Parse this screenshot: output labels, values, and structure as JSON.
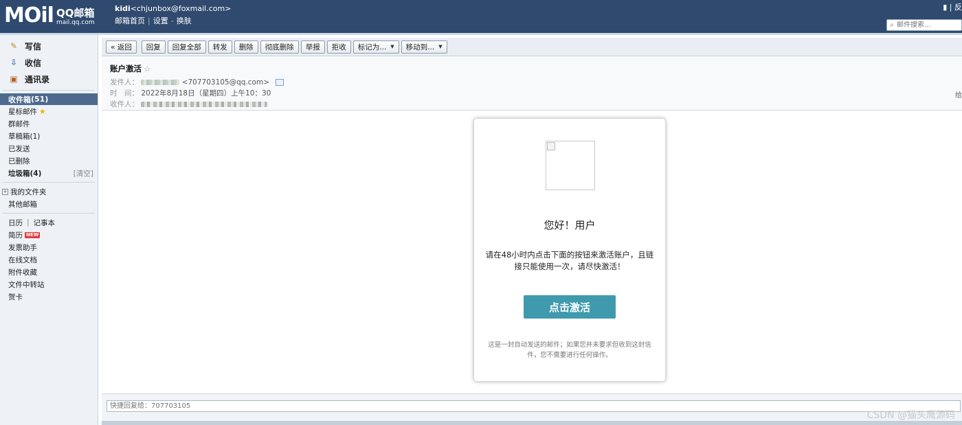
{
  "header": {
    "logo_text": "MOil",
    "logo_brand": "QQ邮箱",
    "logo_url": "mail.qq.com",
    "user_name": "kidi",
    "user_email": "<chjunbox@foxmail.com>",
    "links": [
      "邮箱首页",
      "设置",
      "换肤"
    ],
    "top_right": "反",
    "search_placeholder": "邮件搜索..."
  },
  "sidebar": {
    "compose": [
      {
        "label": "写信",
        "icon": "pencil-note-icon"
      },
      {
        "label": "收信",
        "icon": "inbox-tray-icon"
      },
      {
        "label": "通讯录",
        "icon": "address-book-icon"
      }
    ],
    "inbox": {
      "label": "收件箱",
      "count": "(51)"
    },
    "folders": {
      "starred": "星标邮件",
      "group": "群邮件",
      "drafts": "草稿箱(1)",
      "sent": "已发送",
      "deleted": "已删除",
      "spam": "垃圾箱(4)",
      "spam_clear": "[清空]"
    },
    "my_folders": "我的文件夹",
    "other_mailbox": "其他邮箱",
    "tools": {
      "calendar": "日历",
      "notes": "记事本",
      "resume": "简历",
      "new_badge": "NEW",
      "invoice": "发票助手",
      "online_docs": "在线文档",
      "attachments": "附件收藏",
      "file_transfer": "文件中转站",
      "greeting_card": "贺卡"
    }
  },
  "toolbar": {
    "back": "« 返回",
    "reply": "回复",
    "reply_all": "回复全部",
    "forward": "转发",
    "delete": "删除",
    "delete_perm": "彻底删除",
    "report": "举报",
    "reject": "拒收",
    "mark_as": "标记为...",
    "move_to": "移动到..."
  },
  "mail": {
    "subject": "账户激活",
    "star": "☆",
    "from_label": "发件人：",
    "from_email": "<707703105@qq.com>",
    "time_label": "时　间：",
    "time_value": "2022年8月18日（星期四）上午10：30",
    "to_label": "收件人：",
    "edge_char": "给"
  },
  "card": {
    "greeting": "您好！用户",
    "message": "请在48小时内点击下面的按钮来激活账户，且链接只能使用一次，请尽快激活！",
    "button": "点击激活",
    "footnote": "这是一封自动发送的邮件；如果您并未要求但收到这封信件，您不需要进行任何操作。",
    "button_color": "#3f9aae"
  },
  "quick_reply": {
    "placeholder": "快捷回复给：707703105"
  },
  "watermark": "CSDN @猫头鹰源码",
  "colors": {
    "header_bg": "#2f4a6e",
    "active_folder_bg": "#4d6a8e",
    "sidebar_bg": "#eef2f7"
  }
}
